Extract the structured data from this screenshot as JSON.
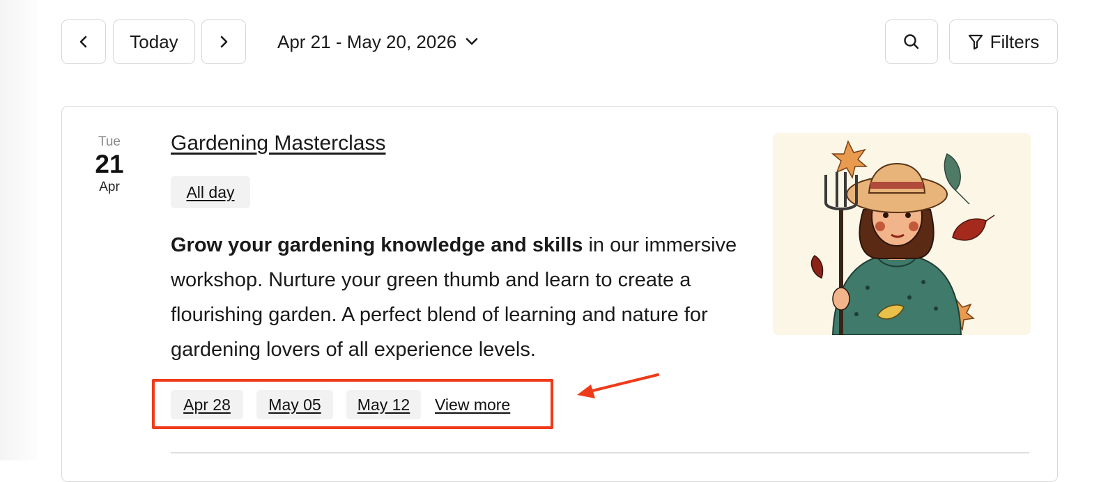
{
  "toolbar": {
    "prev_icon": "chevron-left-icon",
    "today_label": "Today",
    "next_icon": "chevron-right-icon",
    "date_range": "Apr 21 - May 20, 2026",
    "search_icon": "search-icon",
    "filters_label": "Filters"
  },
  "event": {
    "day_of_week": "Tue",
    "day": "21",
    "month": "Apr",
    "title": "Gardening Masterclass",
    "time_chip": "All day",
    "description_bold": "Grow your gardening knowledge and skills",
    "description_rest": " in our immersive workshop. Nurture your green thumb and learn to create a flourishing garden. A perfect blend of learning and nature for gardening lovers of all experience levels.",
    "more_dates": [
      "Apr 28",
      "May 05",
      "May 12"
    ],
    "view_more_label": "View more"
  },
  "colors": {
    "annotation": "#ee3b1a",
    "image_background": "#fbf6e6"
  }
}
